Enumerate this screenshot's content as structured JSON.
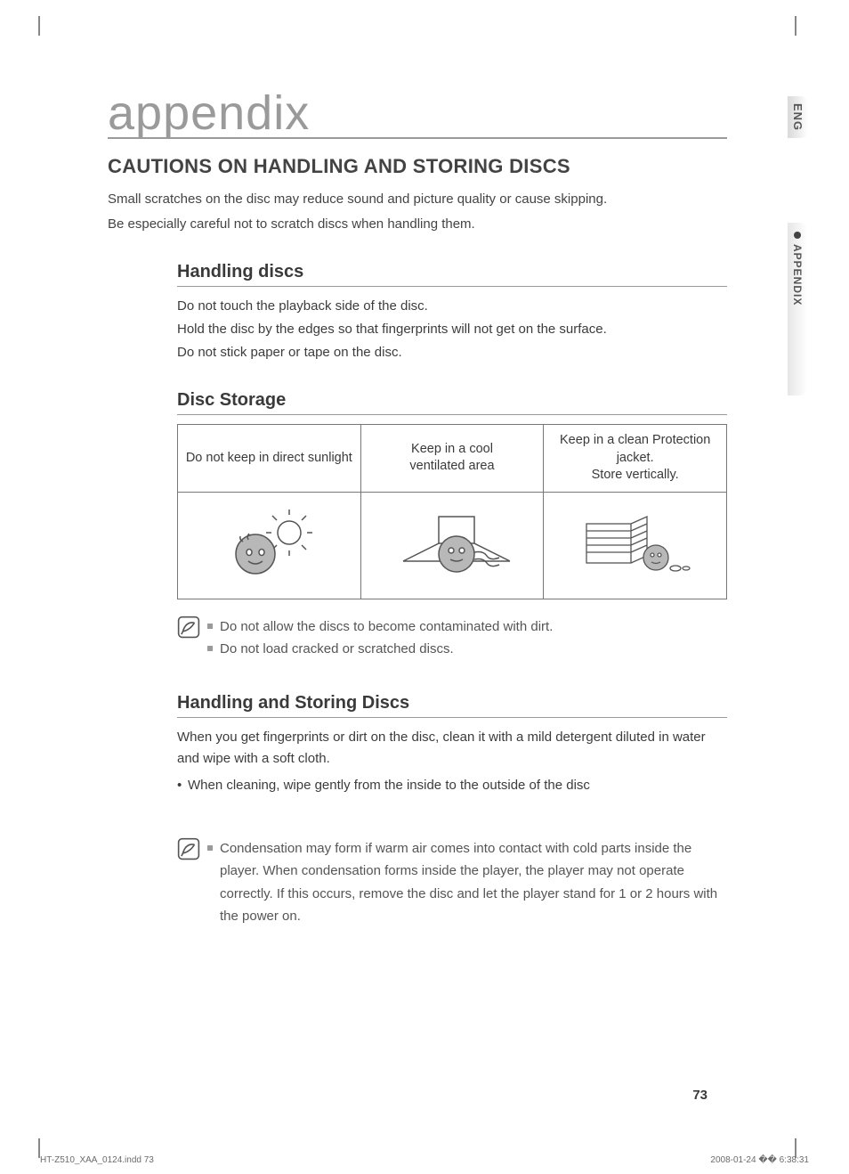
{
  "side": {
    "lang": "ENG",
    "section": "APPENDIX"
  },
  "title": "appendix",
  "h2": "CAUTIONS ON HANDLING AND STORING DISCS",
  "intro1": "Small scratches on the disc may reduce sound and picture quality or cause skipping.",
  "intro2": "Be especially careful not to scratch discs when handling them.",
  "handling": {
    "title": "Handling discs",
    "l1": "Do not touch the playback side of the disc.",
    "l2": "Hold the disc by the edges so that fingerprints will not get on the surface.",
    "l3": "Do not stick paper or tape on the disc."
  },
  "storage": {
    "title": "Disc Storage",
    "h1": "Do not keep in direct sunlight",
    "h2": "Keep in a cool\nventilated area",
    "h3": "Keep in a clean Protection jacket.\nStore vertically."
  },
  "notes1": {
    "n1": "Do not allow the discs to become contaminated with dirt.",
    "n2": "Do not load cracked or scratched discs."
  },
  "handling2": {
    "title": "Handling and Storing Discs",
    "p1": "When you get fingerprints or dirt on the disc, clean it with a mild detergent diluted in water and wipe with a soft cloth.",
    "b1": "When cleaning, wipe gently from the inside to the outside of the disc"
  },
  "notes2": {
    "n1": "Condensation may form if warm air comes into contact with cold parts inside the player. When condensation forms inside the player, the player may not operate correctly. If this occurs, remove the disc and let the player stand for 1 or 2 hours with the power on."
  },
  "page_number": "73",
  "footer": {
    "left": "HT-Z510_XAA_0124.indd   73",
    "right": "2008-01-24   �� 6:38:31"
  }
}
